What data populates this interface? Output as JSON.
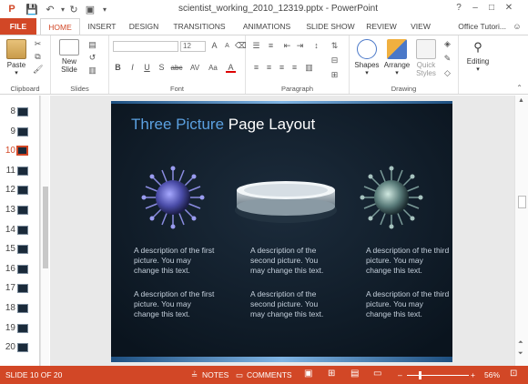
{
  "app": {
    "window_title": "scientist_working_2010_12319.pptx - PowerPoint",
    "window_controls": [
      "?",
      "–",
      "□",
      "✕"
    ]
  },
  "ribbon_tabs": [
    "FILE",
    "HOME",
    "INSERT",
    "DESIGN",
    "TRANSITIONS",
    "ANIMATIONS",
    "SLIDE SHOW",
    "REVIEW",
    "VIEW"
  ],
  "user_menu": "Office Tutori...",
  "ribbon": {
    "clipboard": {
      "paste": "Paste",
      "group": "Clipboard"
    },
    "slides": {
      "new_slide_line1": "New",
      "new_slide_line2": "Slide",
      "group": "Slides"
    },
    "font": {
      "font_size": "12",
      "group": "Font",
      "bold": "B",
      "italic": "I",
      "underline": "U",
      "strike": "S",
      "shadow": "abc",
      "spacing": "AV",
      "case": "Aa",
      "color": "A"
    },
    "paragraph": {
      "group": "Paragraph"
    },
    "drawing": {
      "shapes": "Shapes",
      "arrange": "Arrange",
      "quick_styles_line1": "Quick",
      "quick_styles_line2": "Styles",
      "group": "Drawing"
    },
    "editing": {
      "label": "Editing"
    }
  },
  "thumbnails": [
    {
      "num": "8"
    },
    {
      "num": "9"
    },
    {
      "num": "10"
    },
    {
      "num": "11"
    },
    {
      "num": "12"
    },
    {
      "num": "13"
    },
    {
      "num": "14"
    },
    {
      "num": "15"
    },
    {
      "num": "16"
    },
    {
      "num": "17"
    },
    {
      "num": "18"
    },
    {
      "num": "19"
    },
    {
      "num": "20"
    }
  ],
  "active_slide_num": "10",
  "slide": {
    "title_accent": "Three Picture",
    "title_rest": " Page Layout",
    "columns": [
      {
        "desc1": "A description of the first picture.  You may change this text.",
        "desc2": "A description of the first picture.  You may change this text."
      },
      {
        "desc1": "A description of the second picture.  You may change this text.",
        "desc2": "A description of the second picture.  You may change this text."
      },
      {
        "desc1": "A description of the third picture.  You may change this text.",
        "desc2": "A description of the third picture.  You may change this text."
      }
    ]
  },
  "statusbar": {
    "slide_info": "SLIDE 10 OF 20",
    "notes": "NOTES",
    "comments": "COMMENTS",
    "zoom": "56%",
    "zoom_minus": "–",
    "zoom_plus": "+"
  },
  "colors": {
    "accent": "#d24726",
    "slide_bg": "#0e1a26",
    "title_accent": "#5ba0e0"
  }
}
